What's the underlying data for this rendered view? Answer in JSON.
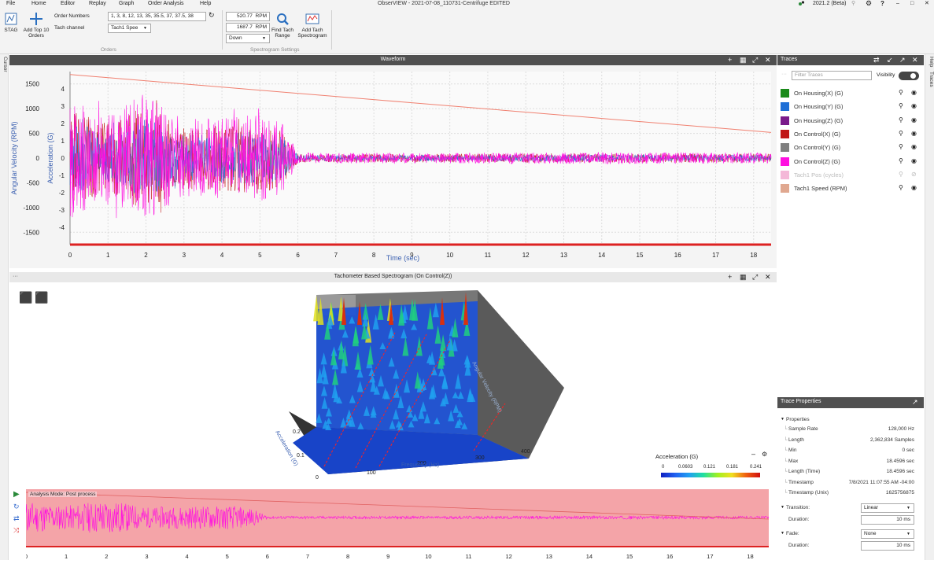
{
  "menu": [
    "File",
    "Home",
    "Editor",
    "Replay",
    "Graph",
    "Order Analysis",
    "Help"
  ],
  "menu_active": "Order Analysis",
  "window_title": "ObserVIEW - 2021-07-08_110731-Centrifuge EDITED",
  "version_label": "2021.2 (Beta)",
  "window_controls": {
    "minimize": "–",
    "maximize": "□",
    "close": "✕"
  },
  "ribbon": {
    "stag_label": "STAG",
    "add_top10_label": "Add Top 10 Orders",
    "order_numbers_label": "Order Numbers",
    "order_numbers_value": "1, 3, 8, 12, 13, 35, 35.5, 37, 37.5, 38",
    "tach_channel_label": "Tach channel",
    "tach_channel_value": "Tach1 Spee",
    "orders_group": "Orders",
    "rpm_max_value": "520.77",
    "rpm_min_value": "1687.7",
    "rpm_unit": "RPM",
    "direction_value": "Down",
    "find_tach_label": "Find Tach Range",
    "add_tach_spectrogram_label": "Add Tach Spectrogram",
    "spectrogram_group": "Spectrogram Settings"
  },
  "side_tabs": {
    "left": "Cursor",
    "right_help": "Help",
    "right_traces": "Traces"
  },
  "waveform": {
    "title": "Waveform",
    "xlabel": "Time (sec)",
    "ylabel_left": "Angular Velocity (RPM)",
    "ylabel_right": "Acceleration (G)"
  },
  "spectrogram": {
    "title": "Tachometer Based Spectrogram (On Control(Z))",
    "axis_acceleration": "Acceleration (G)",
    "axis_frequency": "Frequency (Hz)",
    "axis_velocity": "Angular Velocity (RPM)",
    "colorbar_title": "Acceleration  (G)",
    "colorbar_ticks": [
      "0",
      "0.0603",
      "0.121",
      "0.181",
      "0.241"
    ]
  },
  "overview": {
    "mode_label": "Analysis Mode: Post process"
  },
  "traces_panel": {
    "title": "Traces",
    "filter_placeholder": "Filter Traces",
    "visibility_label": "Visibility",
    "items": [
      {
        "label": "On Housing(X) (G)",
        "color": "#1a8a1a",
        "enabled": true
      },
      {
        "label": "On Housing(Y) (G)",
        "color": "#1f6fd6",
        "enabled": true
      },
      {
        "label": "On Housing(Z) (G)",
        "color": "#7a1a8a",
        "enabled": true
      },
      {
        "label": "On Control(X) (G)",
        "color": "#c01818",
        "enabled": true
      },
      {
        "label": "On Control(Y) (G)",
        "color": "#808080",
        "enabled": true
      },
      {
        "label": "On Control(Z) (G)",
        "color": "#ff10e0",
        "enabled": true
      },
      {
        "label": "Tach1 Pos (cycles)",
        "color": "#f4b8d8",
        "enabled": false
      },
      {
        "label": "Tach1 Speed (RPM)",
        "color": "#e0a890",
        "enabled": true
      }
    ]
  },
  "trace_properties": {
    "title": "Trace Properties",
    "section": "Properties",
    "rows": [
      {
        "key": "Sample Rate",
        "value": "128,000 Hz"
      },
      {
        "key": "Length",
        "value": "2,362,834 Samples"
      },
      {
        "key": "Min",
        "value": "0 sec"
      },
      {
        "key": "Max",
        "value": "18.4596 sec"
      },
      {
        "key": "Length (Time)",
        "value": "18.4596 sec"
      },
      {
        "key": "Timestamp",
        "value": "7/8/2021 11:07:55 AM -04:00"
      },
      {
        "key": "Timestamp (Unix)",
        "value": "1625756875"
      }
    ],
    "transition_label": "Transition:",
    "transition_value": "Linear",
    "transition_duration_label": "Duration:",
    "transition_duration_value": "10  ms",
    "fade_label": "Fade:",
    "fade_value": "None",
    "fade_duration_label": "Duration:",
    "fade_duration_value": "10  ms"
  },
  "chart_data": [
    {
      "type": "line",
      "title": "Waveform",
      "xlabel": "Time (sec)",
      "ylabel": "Angular Velocity (RPM)",
      "y2label": "Acceleration (G)",
      "xlim": [
        0,
        18.46
      ],
      "ylim": [
        -1750,
        1750
      ],
      "y2lim": [
        -5,
        5
      ],
      "x_ticks": [
        0,
        1,
        2,
        3,
        4,
        5,
        6,
        7,
        8,
        9,
        10,
        11,
        12,
        13,
        14,
        15,
        16,
        17,
        18
      ],
      "y_ticks": [
        -1500,
        -1000,
        -500,
        0,
        500,
        1000,
        1500
      ],
      "y2_ticks": [
        -4,
        -3,
        -2,
        -1,
        0,
        1,
        2,
        3,
        4
      ],
      "grid": true,
      "series": [
        {
          "name": "Tach1 Speed (RPM)",
          "color": "#f08070",
          "x": [
            0,
            18.46
          ],
          "y": [
            1690,
            520
          ]
        },
        {
          "name": "On Control(Z) (G)",
          "color": "#ff10e0",
          "envelope": {
            "x": [
              0,
              1,
              2,
              3,
              4,
              5,
              5.6,
              6,
              10,
              14,
              18.46
            ],
            "amp_g": [
              3.5,
              2.5,
              3.8,
              2.2,
              2.4,
              2.6,
              2.0,
              0.3,
              0.3,
              0.35,
              0.3
            ]
          }
        }
      ]
    }
  ]
}
